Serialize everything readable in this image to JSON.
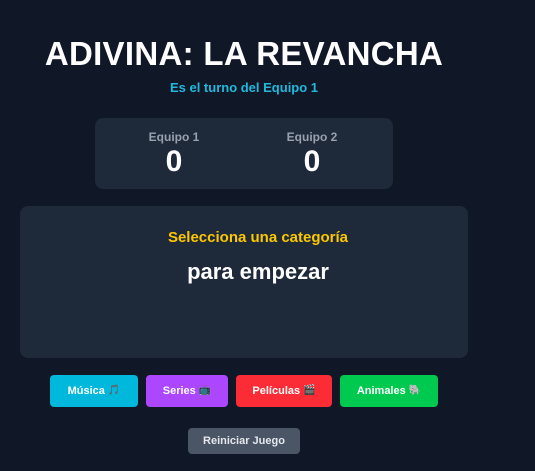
{
  "header": {
    "title": "ADIVINA: LA REVANCHA",
    "turn_text": "Es el turno del Equipo 1"
  },
  "scoreboard": {
    "teams": [
      {
        "name": "Equipo 1",
        "score": "0"
      },
      {
        "name": "Equipo 2",
        "score": "0"
      }
    ]
  },
  "card": {
    "category_prompt": "Selecciona una categoría",
    "word": "para empezar"
  },
  "categories": [
    {
      "label": "Música",
      "icon": "🎵",
      "icon_name": "music-note-icon",
      "color": "#00b8db"
    },
    {
      "label": "Series",
      "icon": "📺",
      "icon_name": "tv-icon",
      "color": "#ad46ff"
    },
    {
      "label": "Películas",
      "icon": "🎬",
      "icon_name": "clapper-icon",
      "color": "#fb2c36"
    },
    {
      "label": "Animales",
      "icon": "🐘",
      "icon_name": "elephant-icon",
      "color": "#00c950"
    }
  ],
  "controls": {
    "reset_label": "Reiniciar Juego"
  },
  "colors": {
    "background": "#101828",
    "panel": "#1e2939",
    "accent_turn": "#22b8dc",
    "accent_category": "#fdc700"
  }
}
